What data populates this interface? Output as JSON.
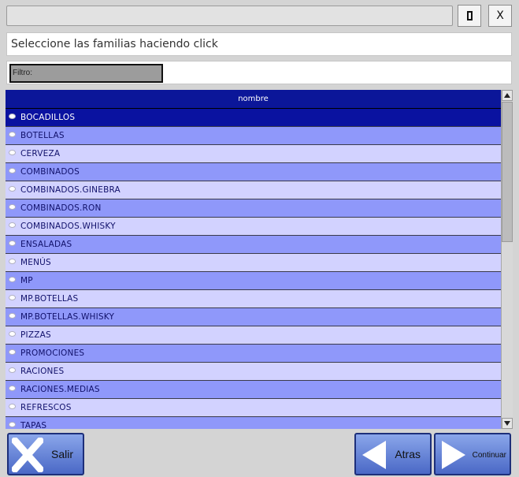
{
  "window": {
    "maximize_icon": "maximize-icon",
    "close_label": "X"
  },
  "instruction": "Seleccione las familias haciendo click",
  "filter": {
    "label": "Filtro:"
  },
  "grid": {
    "column_header": "nombre",
    "rows": [
      "BOCADILLOS",
      "BOTELLAS",
      "CERVEZA",
      "COMBINADOS",
      "COMBINADOS.GINEBRA",
      "COMBINADOS.RON",
      "COMBINADOS.WHISKY",
      "ENSALADAS",
      "MENÚS",
      "MP",
      "MP.BOTELLAS",
      "MP.BOTELLAS.WHISKY",
      "PIZZAS",
      "PROMOCIONES",
      "RACIONES",
      "RACIONES.MEDIAS",
      "REFRESCOS",
      "TAPAS"
    ],
    "selected_index": 0
  },
  "buttons": {
    "salir": "Salir",
    "atras": "Atras",
    "continuar": "Continuar"
  },
  "colors": {
    "selected_row": "#0a12a0",
    "odd_row": "#8f98fa",
    "even_row": "#d2d2ff",
    "header": "#0b1699"
  }
}
